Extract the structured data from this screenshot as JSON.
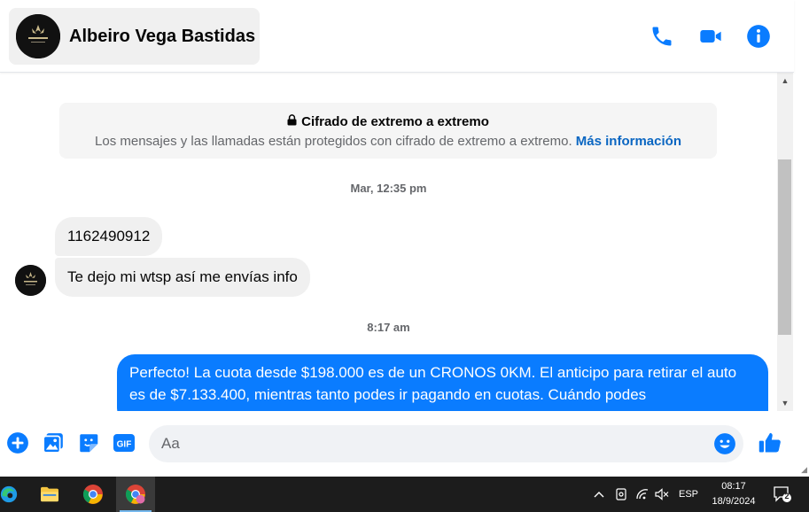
{
  "header": {
    "contact_name": "Albeiro Vega Bastidas",
    "accent_color": "#0a7cff",
    "icons": [
      "phone-icon",
      "video-camera-icon",
      "info-icon"
    ]
  },
  "encryption": {
    "title": "Cifrado de extremo a extremo",
    "body": "Los mensajes y las llamadas están protegidos con cifrado de extremo a extremo.",
    "link": "Más información"
  },
  "messages": {
    "timestamp_1": "Mar, 12:35 pm",
    "incoming": [
      {
        "text": "1162490912"
      },
      {
        "text": "Te dejo mi wtsp así me envías info"
      }
    ],
    "timestamp_2": "8:17 am",
    "outgoing": [
      {
        "text": "Perfecto! La cuota desde $198.000 es de un CRONOS 0KM. El anticipo para retirar el auto es de $7.133.400, mientras tanto podes ir pagando en cuotas. Cuándo podes"
      }
    ]
  },
  "composer": {
    "placeholder": "Aa",
    "icons": [
      "add-icon",
      "gallery-icon",
      "sticker-icon",
      "gif-icon",
      "emoji-icon",
      "thumbs-up-icon"
    ],
    "gif_label": "GIF"
  },
  "taskbar": {
    "apps": [
      "edge-icon",
      "file-explorer-icon",
      "chrome-icon",
      "chrome-profile-icon"
    ],
    "language": "ESP",
    "time": "08:17",
    "date": "18/9/2024",
    "notification_count": "2"
  }
}
